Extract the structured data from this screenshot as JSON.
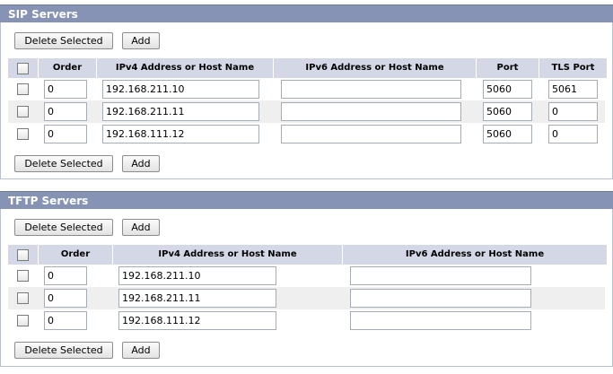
{
  "sip": {
    "title": "SIP Servers",
    "delete_label": "Delete Selected",
    "add_label": "Add",
    "columns": {
      "order": "Order",
      "ipv4": "IPv4 Address or Host Name",
      "ipv6": "IPv6 Address or Host Name",
      "port": "Port",
      "tls_port": "TLS Port"
    },
    "rows": [
      {
        "order": "0",
        "ipv4": "192.168.211.10",
        "ipv6": "",
        "port": "5060",
        "tls_port": "5061"
      },
      {
        "order": "0",
        "ipv4": "192.168.211.11",
        "ipv6": "",
        "port": "5060",
        "tls_port": "0"
      },
      {
        "order": "0",
        "ipv4": "192.168.111.12",
        "ipv6": "",
        "port": "5060",
        "tls_port": "0"
      }
    ]
  },
  "tftp": {
    "title": "TFTP Servers",
    "delete_label": "Delete Selected",
    "add_label": "Add",
    "columns": {
      "order": "Order",
      "ipv4": "IPv4 Address or Host Name",
      "ipv6": "IPv6 Address or Host Name"
    },
    "rows": [
      {
        "order": "0",
        "ipv4": "192.168.211.10",
        "ipv6": ""
      },
      {
        "order": "0",
        "ipv4": "192.168.211.11",
        "ipv6": ""
      },
      {
        "order": "0",
        "ipv4": "192.168.111.12",
        "ipv6": ""
      }
    ]
  },
  "colors": {
    "header_bar": "#8693b4",
    "column_header": "#d4d8e6",
    "alt_row": "#efefef"
  }
}
